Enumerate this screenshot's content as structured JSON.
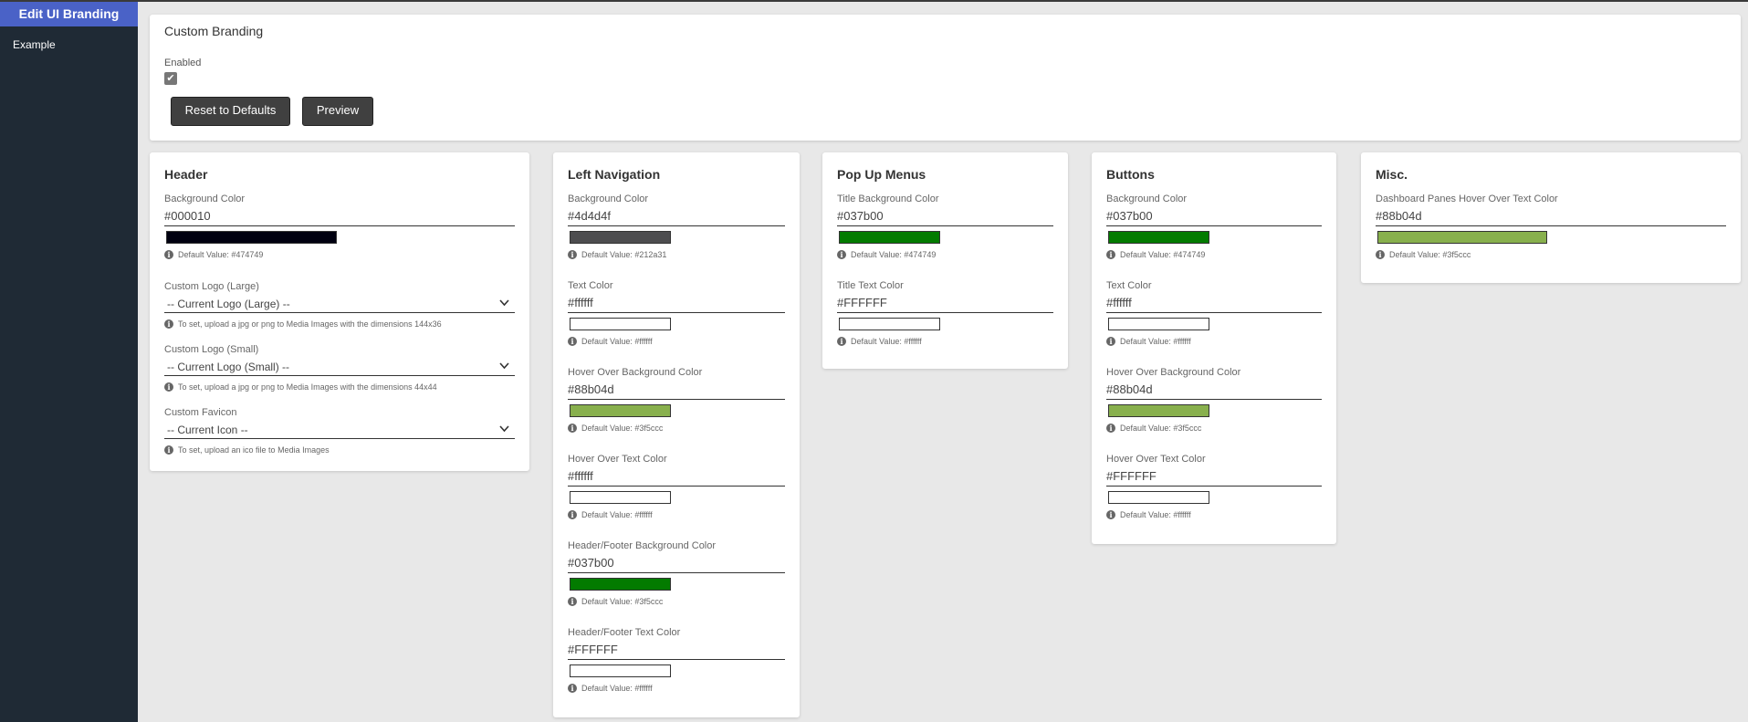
{
  "sidebar": {
    "title": "Edit UI Branding",
    "items": [
      {
        "label": "Example"
      }
    ]
  },
  "top": {
    "title": "Custom Branding",
    "enabled_label": "Enabled",
    "enabled_checked": true,
    "reset_label": "Reset to Defaults",
    "preview_label": "Preview"
  },
  "header": {
    "title": "Header",
    "bg_label": "Background Color",
    "bg_value": "#000010",
    "bg_default": "Default Value: #474749",
    "logo_large_label": "Custom Logo (Large)",
    "logo_large_value": "-- Current Logo (Large) --",
    "logo_large_hint": "To set, upload a jpg or png to Media Images with the dimensions 144x36",
    "logo_small_label": "Custom Logo (Small)",
    "logo_small_value": "-- Current Logo (Small) --",
    "logo_small_hint": "To set, upload a jpg or png to Media Images with the dimensions 44x44",
    "favicon_label": "Custom Favicon",
    "favicon_value": "-- Current Icon --",
    "favicon_hint": "To set, upload an ico file to Media Images"
  },
  "leftnav": {
    "title": "Left Navigation",
    "fields": [
      {
        "label": "Background Color",
        "value": "#4d4d4f",
        "default": "Default Value: #212a31",
        "color": "#4d4d4f"
      },
      {
        "label": "Text Color",
        "value": "#ffffff",
        "default": "Default Value: #ffffff",
        "color": "#ffffff"
      },
      {
        "label": "Hover Over Background Color",
        "value": "#88b04d",
        "default": "Default Value: #3f5ccc",
        "color": "#88b04d"
      },
      {
        "label": "Hover Over Text Color",
        "value": "#ffffff",
        "default": "Default Value: #ffffff",
        "color": "#ffffff"
      },
      {
        "label": "Header/Footer Background Color",
        "value": "#037b00",
        "default": "Default Value: #3f5ccc",
        "color": "#037b00"
      },
      {
        "label": "Header/Footer Text Color",
        "value": "#FFFFFF",
        "default": "Default Value: #ffffff",
        "color": "#ffffff"
      }
    ]
  },
  "popup": {
    "title": "Pop Up Menus",
    "fields": [
      {
        "label": "Title Background Color",
        "value": "#037b00",
        "default": "Default Value: #474749",
        "color": "#037b00"
      },
      {
        "label": "Title Text Color",
        "value": "#FFFFFF",
        "default": "Default Value: #ffffff",
        "color": "#ffffff"
      }
    ]
  },
  "buttons": {
    "title": "Buttons",
    "fields": [
      {
        "label": "Background Color",
        "value": "#037b00",
        "default": "Default Value: #474749",
        "color": "#037b00"
      },
      {
        "label": "Text Color",
        "value": "#ffffff",
        "default": "Default Value: #ffffff",
        "color": "#ffffff"
      },
      {
        "label": "Hover Over Background Color",
        "value": "#88b04d",
        "default": "Default Value: #3f5ccc",
        "color": "#88b04d"
      },
      {
        "label": "Hover Over Text Color",
        "value": "#FFFFFF",
        "default": "Default Value: #ffffff",
        "color": "#ffffff"
      }
    ]
  },
  "misc": {
    "title": "Misc.",
    "fields": [
      {
        "label": "Dashboard Panes Hover Over Text Color",
        "value": "#88b04d",
        "default": "Default Value: #3f5ccc",
        "color": "#88b04d"
      }
    ]
  },
  "colors": {
    "sidebar_bg": "#1f2a35",
    "sidebar_title_bg": "#4a62c7",
    "header_swatch": "#000010",
    "page_bg": "#e8e8e8"
  }
}
